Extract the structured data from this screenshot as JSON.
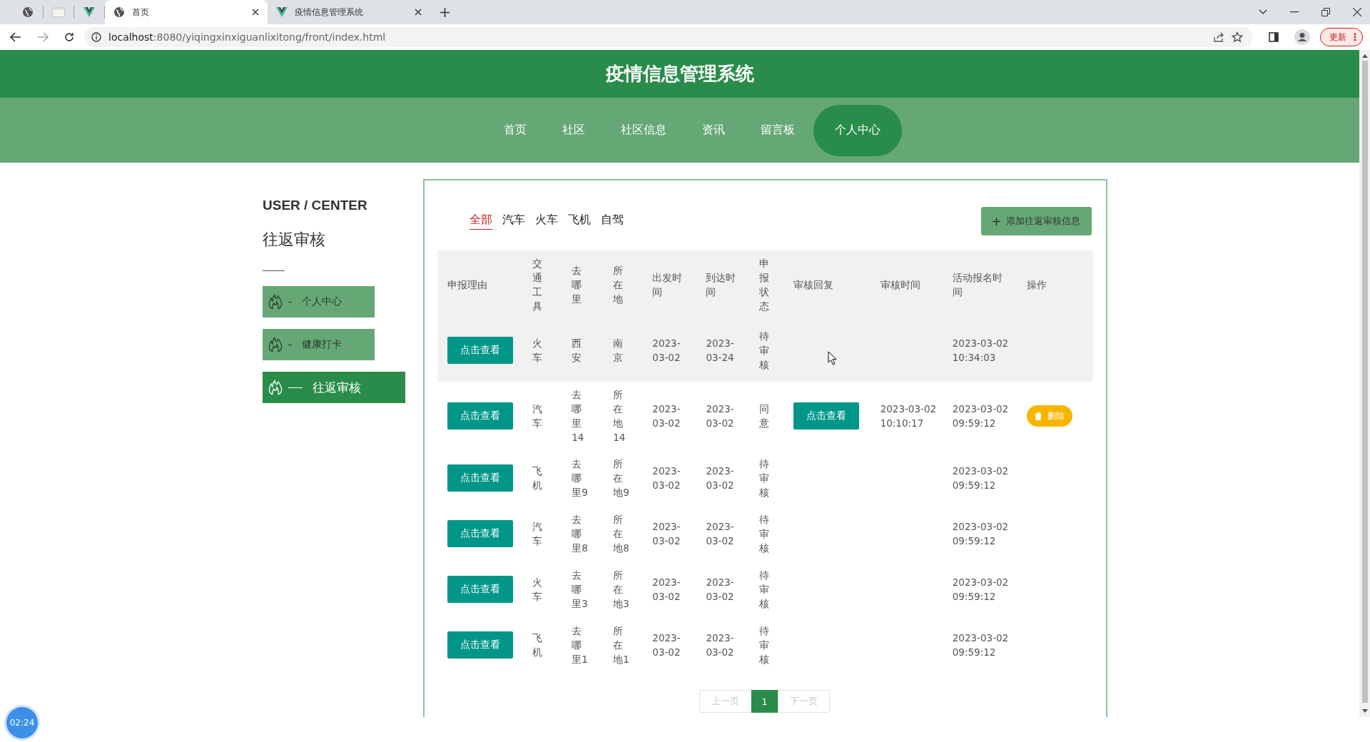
{
  "browser": {
    "tabs": [
      {
        "kind": "pinned-globe",
        "selected": false
      },
      {
        "kind": "pinned-page",
        "selected": false
      },
      {
        "kind": "pinned-vue",
        "selected": false
      },
      {
        "kind": "globe",
        "title": "首页",
        "selected": true
      },
      {
        "kind": "vue",
        "title": "疫情信息管理系统",
        "selected": false
      }
    ],
    "url_host": "localhost",
    "url_rest": ":8080/yiqingxinxiguanlixitong/front/index.html",
    "update_button": "更新"
  },
  "header": {
    "title": "疫情信息管理系统"
  },
  "nav": [
    {
      "label": "首页",
      "selected": false
    },
    {
      "label": "社区",
      "selected": false
    },
    {
      "label": "社区信息",
      "selected": false
    },
    {
      "label": "资讯",
      "selected": false
    },
    {
      "label": "留言板",
      "selected": false
    },
    {
      "label": "个人中心",
      "selected": true
    }
  ],
  "sidebar": {
    "heading": "USER / CENTER",
    "subtitle": "往返审核",
    "items": [
      {
        "label": "个人中心",
        "selected": false
      },
      {
        "label": "健康打卡",
        "selected": false
      },
      {
        "label": "往返审核",
        "selected": true
      }
    ]
  },
  "filters": [
    {
      "label": "全部",
      "selected": true
    },
    {
      "label": "汽车",
      "selected": false
    },
    {
      "label": "火车",
      "selected": false
    },
    {
      "label": "飞机",
      "selected": false
    },
    {
      "label": "自驾",
      "selected": false
    }
  ],
  "add_button": "添加往返审核信息",
  "table": {
    "columns": [
      "申报理由",
      "交通工具",
      "去哪里",
      "所在地",
      "出发时间",
      "到达时间",
      "申报状态",
      "审核回复",
      "审核时间",
      "活动报名时间",
      "操作"
    ],
    "rows": [
      {
        "hovered": true,
        "reason": "点击查看",
        "transport": "火车",
        "destination": "西安",
        "location": "南京",
        "depart": "2023-03-02",
        "arrive": "2023-03-24",
        "status": "待审核",
        "signup_time": "2023-03-02 10:34:03"
      },
      {
        "hovered": false,
        "reason": "点击查看",
        "transport": "汽车",
        "destination": "去哪里14",
        "location": "所在地14",
        "depart": "2023-03-02",
        "arrive": "2023-03-02",
        "status": "同意",
        "reply": "点击查看",
        "review_time": "2023-03-02 10:10:17",
        "signup_time": "2023-03-02 09:59:12",
        "action": "删除"
      },
      {
        "hovered": false,
        "reason": "点击查看",
        "transport": "飞机",
        "destination": "去哪里9",
        "location": "所在地9",
        "depart": "2023-03-02",
        "arrive": "2023-03-02",
        "status": "待审核",
        "signup_time": "2023-03-02 09:59:12"
      },
      {
        "hovered": false,
        "reason": "点击查看",
        "transport": "汽车",
        "destination": "去哪里8",
        "location": "所在地8",
        "depart": "2023-03-02",
        "arrive": "2023-03-02",
        "status": "待审核",
        "signup_time": "2023-03-02 09:59:12"
      },
      {
        "hovered": false,
        "reason": "点击查看",
        "transport": "火车",
        "destination": "去哪里3",
        "location": "所在地3",
        "depart": "2023-03-02",
        "arrive": "2023-03-02",
        "status": "待审核",
        "signup_time": "2023-03-02 09:59:12"
      },
      {
        "hovered": false,
        "reason": "点击查看",
        "transport": "飞机",
        "destination": "去哪里1",
        "location": "所在地1",
        "depart": "2023-03-02",
        "arrive": "2023-03-02",
        "status": "待审核",
        "signup_time": "2023-03-02 09:59:12"
      }
    ]
  },
  "pagination": {
    "prev": {
      "label": "上一页",
      "disabled": true
    },
    "pages": [
      {
        "label": "1",
        "selected": true
      }
    ],
    "next": {
      "label": "下一页",
      "disabled": true
    }
  },
  "timer": "02:24"
}
